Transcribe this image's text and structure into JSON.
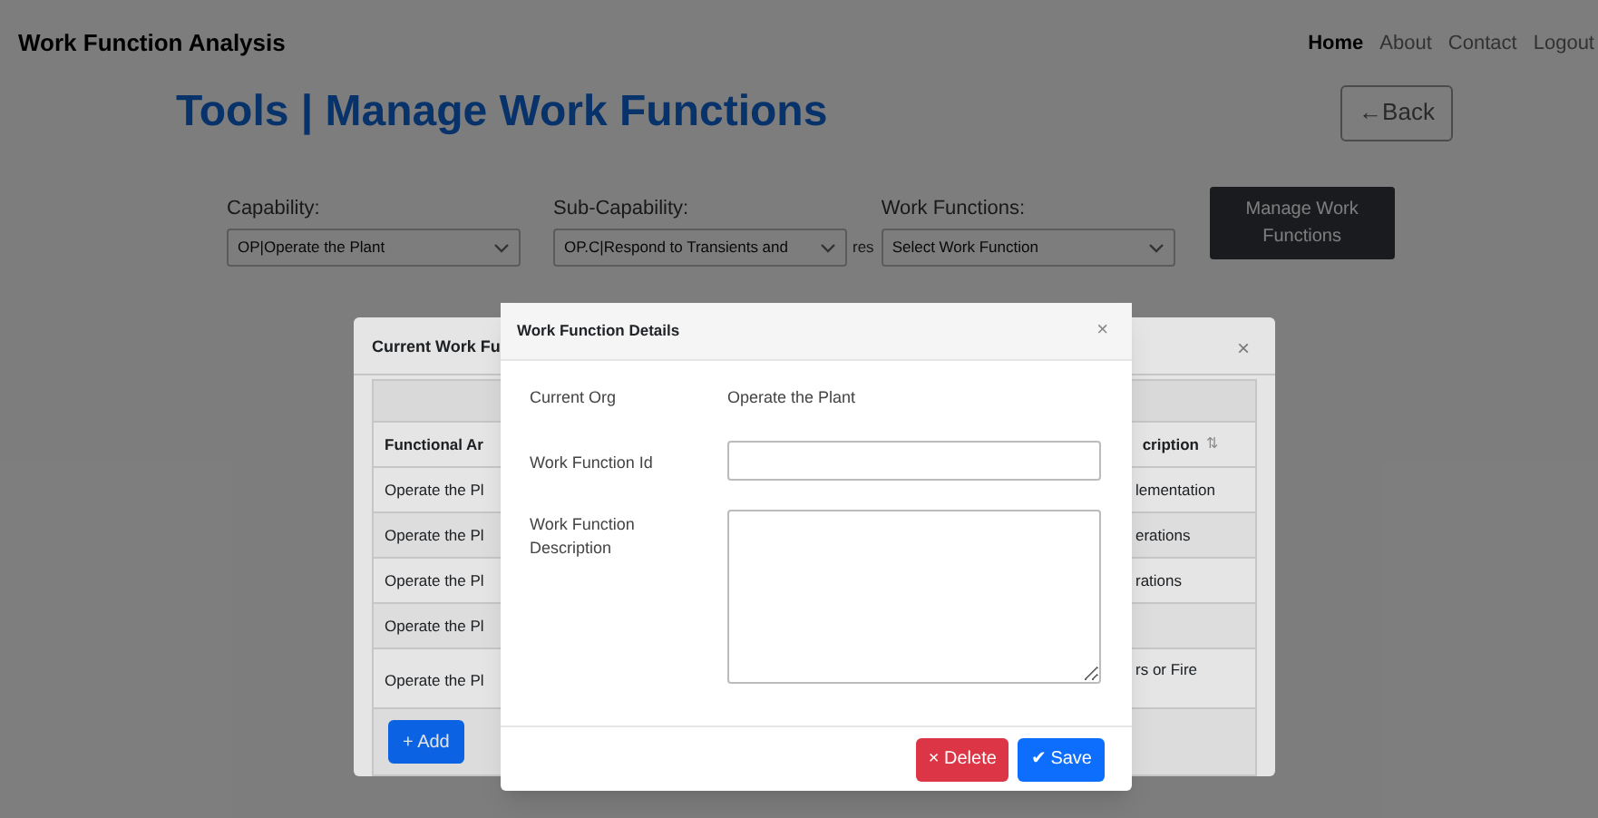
{
  "navbar": {
    "brand": "Work Function Analysis",
    "links": [
      {
        "label": "Home",
        "selected": true
      },
      {
        "label": "About",
        "selected": false
      },
      {
        "label": "Contact",
        "selected": false
      },
      {
        "label": "Logout",
        "selected": false
      }
    ]
  },
  "page": {
    "title_prefix": "Tools |",
    "title": "Manage Work Functions",
    "back_button": "←Back"
  },
  "filters": [
    {
      "label": "Capability:",
      "value": "OP|Operate the Plant"
    },
    {
      "label": "Sub-Capability:",
      "value": "OP.C|Respond to Transients and",
      "suffix": "res"
    },
    {
      "label": "Work Functions:",
      "value": "Select Work Function"
    }
  ],
  "manage_button": "Manage Work Functions",
  "list_modal": {
    "title": "Current Work Fu",
    "close": "×",
    "columns": [
      {
        "label": "Functional Ar"
      },
      {
        "label": "cription",
        "sort_icon": "⇅"
      }
    ],
    "rows": [
      [
        "Operate the Pl",
        "lementation"
      ],
      [
        "Operate the Pl",
        "erations"
      ],
      [
        "Operate the Pl",
        "rations"
      ],
      [
        "Operate the Pl",
        ""
      ],
      [
        "Operate the Pl",
        "rs or Fire"
      ]
    ],
    "add_button": "+ Add"
  },
  "details_modal": {
    "title": "Work Function Details",
    "close": "×",
    "fields": [
      {
        "kind": "text",
        "label": "Current Org",
        "value": "Operate the Plant"
      },
      {
        "kind": "input",
        "label": "Work Function Id"
      },
      {
        "kind": "textarea",
        "label": "Work Function Description"
      }
    ],
    "buttons": [
      {
        "kind": "danger",
        "icon": "×",
        "label": "Delete"
      },
      {
        "kind": "primary",
        "icon": "✔",
        "label": "Save"
      }
    ]
  }
}
